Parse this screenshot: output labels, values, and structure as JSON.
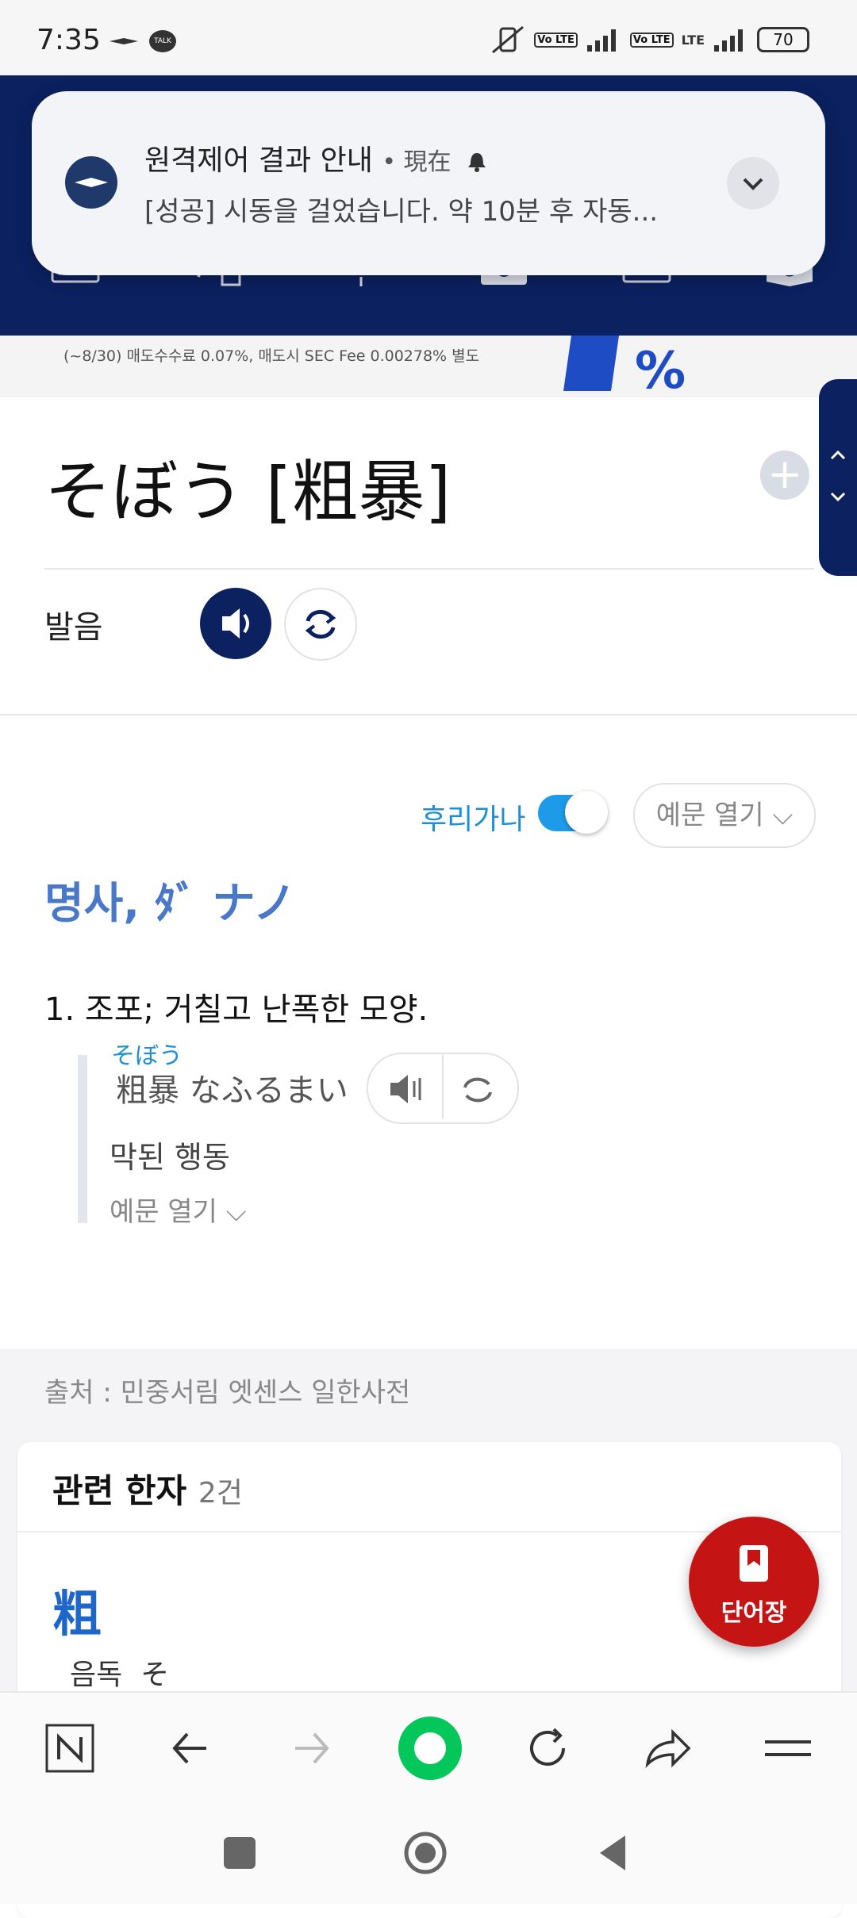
{
  "status_bar": {
    "time": "7:35",
    "kakao": "TALK",
    "volte1": "Vo LTE",
    "volte2": "Vo LTE",
    "lte": "LTE",
    "battery": "70"
  },
  "notification": {
    "title": "원격제어 결과 안내",
    "time": "• 現在",
    "body": "[성공] 시동을 걸었습니다. 약 10분 후 자동..."
  },
  "ad_banner": {
    "text": "(~8/30) 매도수수료 0.07%, 매도시 SEC Fee 0.00278% 별도"
  },
  "entry": {
    "title": "そぼう [粗暴]",
    "pronunciation_label": "발음",
    "furigana_label": "후리가나",
    "example_open_label": "예문 열기 ⌵",
    "part_of_speech": "명사, ﾀﾞ ナノ",
    "sense_number": "1.",
    "sense_text": "조포; 거칠고 난폭한 모양.",
    "example": {
      "furigana": "そぼう",
      "japanese": "粗暴 なふるまい",
      "korean": "막된 행동",
      "open_label": "예문 열기 ⌵"
    },
    "source": "출처 : 민중서림 엣센스 일한사전"
  },
  "related_kanji": {
    "title": "관련 한자",
    "count": "2건",
    "items": [
      {
        "kanji": "粗",
        "reading_label": "음독",
        "reading": "そ"
      }
    ]
  },
  "fab": {
    "label": "단어장"
  },
  "colors": {
    "navy": "#0b2160",
    "accent_blue": "#1e8fd6",
    "pos_blue": "#4a78c8",
    "fab_red": "#c41414",
    "toggle_blue": "#1e9be8",
    "naver_green": "#03c75a"
  }
}
